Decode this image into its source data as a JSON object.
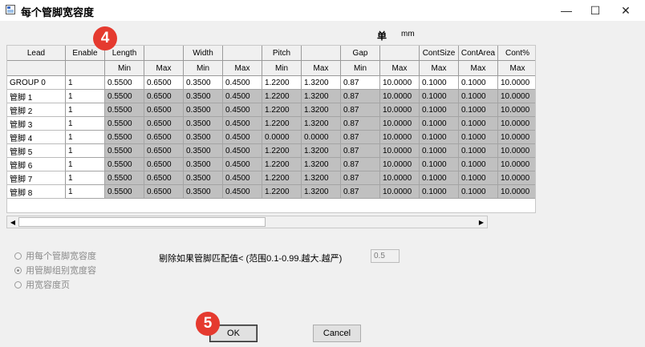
{
  "window": {
    "title": "每个管脚宽容度",
    "minimize_glyph": "—",
    "maximize_glyph": "☐",
    "close_glyph": "✕"
  },
  "unit": {
    "label": "单",
    "value": "mm"
  },
  "grid": {
    "groups": [
      "Lead",
      "Enable",
      "Length",
      "",
      "Width",
      "",
      "Pitch",
      "",
      "Gap",
      "",
      "ContSize",
      "ContArea",
      "Cont%"
    ],
    "subheaders": [
      "",
      "",
      "Min",
      "Max",
      "Min",
      "Max",
      "Min",
      "Max",
      "Min",
      "Max",
      "Max",
      "Max",
      "Max"
    ],
    "rows": [
      {
        "lead": "GROUP 0",
        "values": [
          "1",
          "0.5500",
          "0.6500",
          "0.3500",
          "0.4500",
          "1.2200",
          "1.3200",
          "0.87",
          "10.0000",
          "0.1000",
          "0.1000",
          "10.0000"
        ]
      },
      {
        "lead": "管脚 1",
        "values": [
          "1",
          "0.5500",
          "0.6500",
          "0.3500",
          "0.4500",
          "1.2200",
          "1.3200",
          "0.87",
          "10.0000",
          "0.1000",
          "0.1000",
          "10.0000"
        ]
      },
      {
        "lead": "管脚 2",
        "values": [
          "1",
          "0.5500",
          "0.6500",
          "0.3500",
          "0.4500",
          "1.2200",
          "1.3200",
          "0.87",
          "10.0000",
          "0.1000",
          "0.1000",
          "10.0000"
        ]
      },
      {
        "lead": "管脚 3",
        "values": [
          "1",
          "0.5500",
          "0.6500",
          "0.3500",
          "0.4500",
          "1.2200",
          "1.3200",
          "0.87",
          "10.0000",
          "0.1000",
          "0.1000",
          "10.0000"
        ]
      },
      {
        "lead": "管脚 4",
        "values": [
          "1",
          "0.5500",
          "0.6500",
          "0.3500",
          "0.4500",
          "0.0000",
          "0.0000",
          "0.87",
          "10.0000",
          "0.1000",
          "0.1000",
          "10.0000"
        ]
      },
      {
        "lead": "管脚 5",
        "values": [
          "1",
          "0.5500",
          "0.6500",
          "0.3500",
          "0.4500",
          "1.2200",
          "1.3200",
          "0.87",
          "10.0000",
          "0.1000",
          "0.1000",
          "10.0000"
        ]
      },
      {
        "lead": "管脚 6",
        "values": [
          "1",
          "0.5500",
          "0.6500",
          "0.3500",
          "0.4500",
          "1.2200",
          "1.3200",
          "0.87",
          "10.0000",
          "0.1000",
          "0.1000",
          "10.0000"
        ]
      },
      {
        "lead": "管脚 7",
        "values": [
          "1",
          "0.5500",
          "0.6500",
          "0.3500",
          "0.4500",
          "1.2200",
          "1.3200",
          "0.87",
          "10.0000",
          "0.1000",
          "0.1000",
          "10.0000"
        ]
      },
      {
        "lead": "管脚 8",
        "values": [
          "1",
          "0.5500",
          "0.6500",
          "0.3500",
          "0.4500",
          "1.2200",
          "1.3200",
          "0.87",
          "10.0000",
          "0.1000",
          "0.1000",
          "10.0000"
        ]
      }
    ]
  },
  "scroll": {
    "left_arrow": "◀",
    "right_arrow": "▶"
  },
  "options": {
    "radio1": "用每个管脚宽容度",
    "radio2": "用管脚组别宽度容",
    "radio3": "用宽容度页",
    "selected": "radio2"
  },
  "remove": {
    "label": "剔除如果管脚匹配值< (范围0.1-0.99.越大.越严)",
    "value": "0.5"
  },
  "buttons": {
    "ok": "OK",
    "cancel": "Cancel"
  },
  "badges": {
    "b4": "4",
    "b5": "5"
  }
}
